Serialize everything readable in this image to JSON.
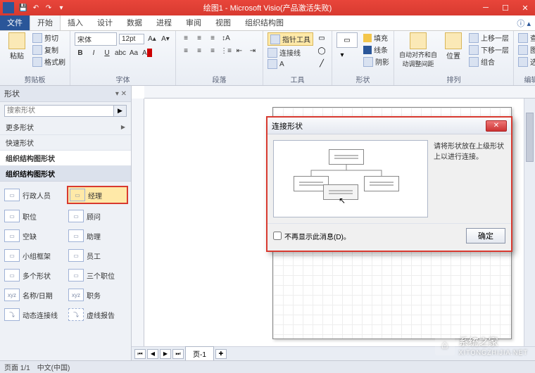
{
  "window": {
    "title": "绘图1 - Microsoft Visio(产品激活失败)"
  },
  "tabs": {
    "file": "文件",
    "items": [
      "开始",
      "插入",
      "设计",
      "数据",
      "进程",
      "审阅",
      "视图",
      "组织结构图"
    ],
    "active_index": 0
  },
  "ribbon": {
    "clipboard": {
      "label": "剪贴板",
      "paste": "粘贴",
      "cut": "剪切",
      "copy": "复制",
      "format_painter": "格式刷"
    },
    "font": {
      "label": "字体",
      "name": "宋体",
      "size": "12pt"
    },
    "paragraph": {
      "label": "段落"
    },
    "tools": {
      "label": "工具",
      "pointer": "指针工具",
      "connector": "连接线",
      "text": "A"
    },
    "shapes": {
      "label": "形状",
      "fill": "填充",
      "line": "线条",
      "shadow": "阴影"
    },
    "arrange": {
      "label": "排列",
      "autoalign": "自动对齐和自动调整间距",
      "position": "位置",
      "bring_forward": "上移一层",
      "send_backward": "下移一层",
      "group": "组合"
    },
    "edit": {
      "label": "编辑",
      "find": "查找",
      "layers": "图层",
      "select": "选择"
    }
  },
  "shapepane": {
    "title": "形状",
    "search_placeholder": "搜索形状",
    "categories": {
      "more": "更多形状",
      "quick": "快速形状",
      "org": "组织结构图形状"
    },
    "stencil_header": "组织结构图形状",
    "shapes": [
      {
        "label": "行政人员"
      },
      {
        "label": "经理"
      },
      {
        "label": "职位"
      },
      {
        "label": "顾问"
      },
      {
        "label": "空缺"
      },
      {
        "label": "助理"
      },
      {
        "label": "小组框架"
      },
      {
        "label": "员工"
      },
      {
        "label": "多个形状"
      },
      {
        "label": "三个职位"
      },
      {
        "label": "名称/日期"
      },
      {
        "label": "职务"
      },
      {
        "label": "动态连接线"
      },
      {
        "label": "虚线报告"
      }
    ],
    "highlighted_index": 1
  },
  "dialog": {
    "title": "连接形状",
    "message": "请将形状放在上级形状上以进行连接。",
    "checkbox": "不再显示此消息(D)。",
    "ok": "确定"
  },
  "pagetabs": {
    "page1": "页-1"
  },
  "statusbar": {
    "page": "页面 1/1",
    "lang": "中文(中国)"
  },
  "watermark": {
    "name": "系统之家",
    "url": "XITONGZHIJIA.NET"
  }
}
